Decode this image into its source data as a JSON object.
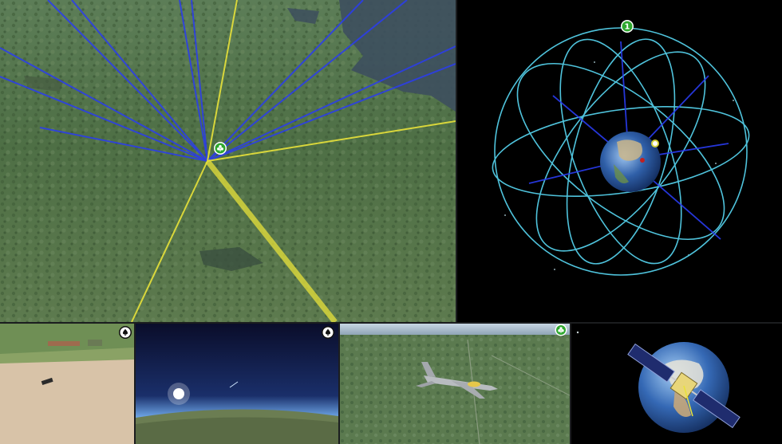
{
  "views": {
    "main": {
      "icon": "club-icon",
      "ray_colors": {
        "satellite_link": "#2a3cf0",
        "ground_link": "#e8e23a"
      }
    },
    "orbit": {
      "marker_label": "1",
      "orbit_color": "#4fc3dc",
      "background": "#000000"
    },
    "thumbnails": [
      {
        "name": "farm-field",
        "icon": "spade-icon"
      },
      {
        "name": "space-horizon",
        "icon": "spade-icon"
      },
      {
        "name": "aircraft",
        "icon": "club-icon",
        "icon_color": "#2fa82f"
      },
      {
        "name": "earth-satellite",
        "icon": "star-dot"
      }
    ]
  }
}
